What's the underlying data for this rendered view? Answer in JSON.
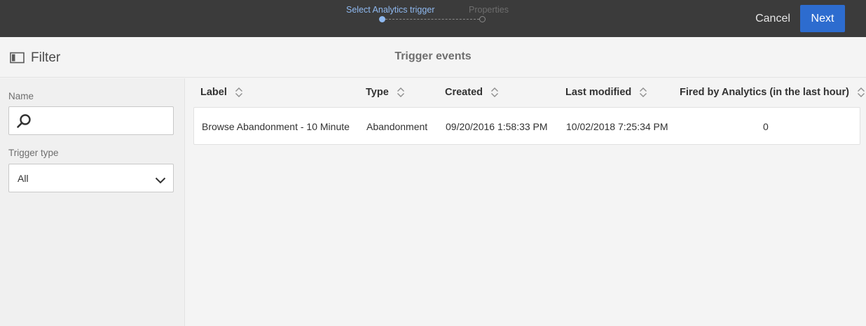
{
  "wizard": {
    "steps": [
      {
        "label": "Select Analytics trigger",
        "active": true
      },
      {
        "label": "Properties",
        "active": false
      }
    ],
    "cancel_label": "Cancel",
    "next_label": "Next"
  },
  "filter": {
    "toggle_label": "Filter",
    "name_label": "Name",
    "name_value": "",
    "name_placeholder": "",
    "trigger_type_label": "Trigger type",
    "trigger_type_value": "All"
  },
  "page": {
    "title": "Trigger events"
  },
  "table": {
    "columns": [
      "Label",
      "Type",
      "Created",
      "Last modified",
      "Fired by Analytics (in the last hour)"
    ],
    "rows": [
      {
        "label": "Browse Abandonment - 10 Minute",
        "type": "Abandonment",
        "created": "09/20/2016 1:58:33 PM",
        "last_modified": "10/02/2018 7:25:34 PM",
        "fired": "0"
      }
    ]
  },
  "colors": {
    "topbar": "#3b3b3b",
    "accent": "#2d6ccf",
    "active_step": "#8fb9f0",
    "background": "#f4f4f4"
  },
  "icons": [
    "filter-panel-icon",
    "search-icon",
    "chevron-down-icon",
    "sort-icon"
  ]
}
